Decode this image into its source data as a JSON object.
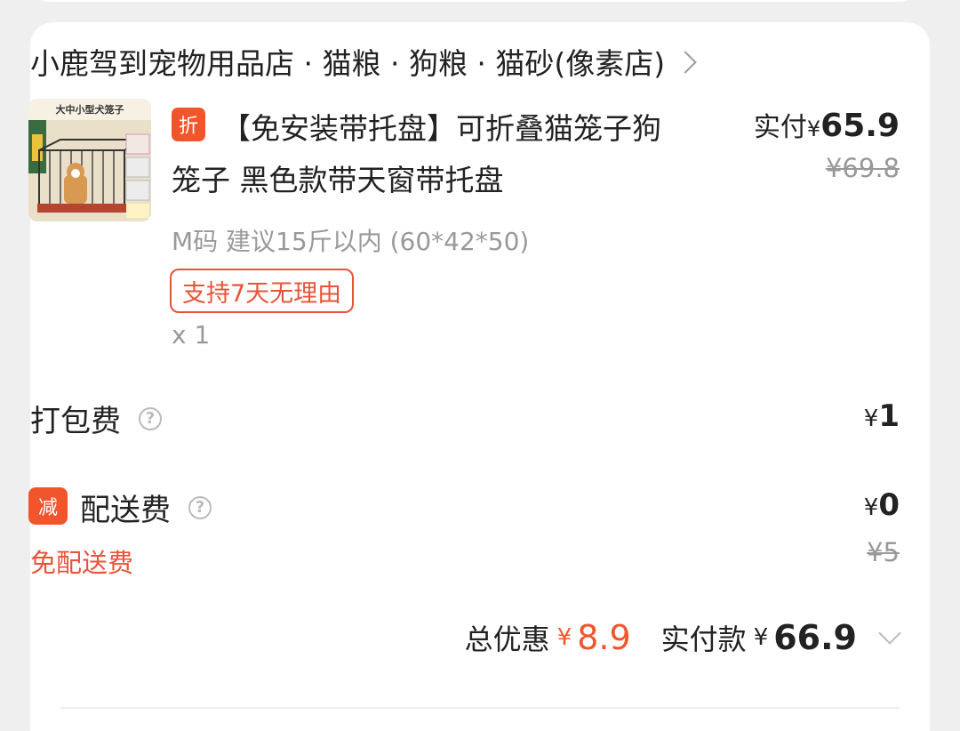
{
  "shop": {
    "name": "小鹿驾到宠物用品店 · 猫粮 · 狗粮 · 猫砂(像素店)",
    "chevron_icon": "chevron-right-icon"
  },
  "product": {
    "thumbnail_text": "大中小型犬笼子",
    "discount_badge": "折",
    "title": "【免安装带托盘】可折叠猫笼子狗笼子 黑色款带天窗带托盘",
    "spec": "M码 建议15斤以内 (60*42*50)",
    "return_tag": "支持7天无理由",
    "quantity": "x 1",
    "paid_label": "实付",
    "paid_yen": "¥",
    "paid_amount": "65.9",
    "original_price": "¥69.8"
  },
  "fees": {
    "packing_label": "打包费",
    "packing_yen": "¥",
    "packing_value": "1",
    "delivery_badge": "减",
    "delivery_label": "配送费",
    "delivery_yen": "¥",
    "delivery_value": "0",
    "delivery_original": "¥5",
    "free_delivery_text": "免配送费"
  },
  "totals": {
    "discount_label": "总优惠",
    "discount_yen": "¥",
    "discount_amount": "8.9",
    "pay_label": "实付款",
    "pay_yen": "¥",
    "pay_amount": "66.9"
  },
  "colors": {
    "accent": "#f2552c",
    "tag_red": "#e8533a",
    "muted": "#999999"
  }
}
